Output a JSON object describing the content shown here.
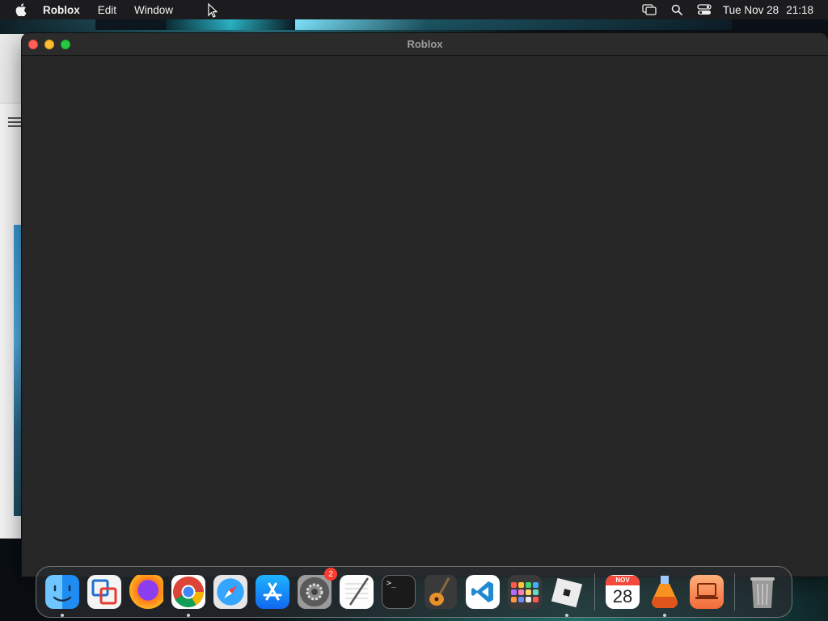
{
  "menubar": {
    "apple_icon": "apple-logo-icon",
    "app_name": "Roblox",
    "menus": [
      "Edit",
      "Window"
    ],
    "status_icons": [
      "screen-mirroring-icon",
      "spotlight-search-icon",
      "control-center-icon"
    ],
    "clock_date": "Tue Nov 28",
    "clock_time": "21:18"
  },
  "window": {
    "title": "Roblox",
    "controls": [
      "close",
      "minimize",
      "zoom"
    ]
  },
  "dock": {
    "apps": [
      {
        "name": "Finder",
        "icon": "finder-icon",
        "running": true
      },
      {
        "name": "VMware Fusion",
        "icon": "vmware-icon",
        "running": false
      },
      {
        "name": "Firefox",
        "icon": "firefox-icon",
        "running": false
      },
      {
        "name": "Google Chrome",
        "icon": "chrome-icon",
        "running": true
      },
      {
        "name": "Safari",
        "icon": "safari-icon",
        "running": false
      },
      {
        "name": "App Store",
        "icon": "app-store-icon",
        "running": false
      },
      {
        "name": "System Settings",
        "icon": "system-settings-icon",
        "running": false,
        "badge": "2"
      },
      {
        "name": "TextEdit",
        "icon": "textedit-icon",
        "running": false
      },
      {
        "name": "Terminal",
        "icon": "terminal-icon",
        "running": false,
        "glyph": ">_"
      },
      {
        "name": "GarageBand",
        "icon": "garageband-icon",
        "running": false
      },
      {
        "name": "Visual Studio Code",
        "icon": "vscode-icon",
        "running": false
      },
      {
        "name": "Launchpad",
        "icon": "launchpad-icon",
        "running": false
      },
      {
        "name": "Roblox",
        "icon": "roblox-icon",
        "running": true
      }
    ],
    "recent": [
      {
        "name": "Calendar",
        "icon": "calendar-icon",
        "running": false,
        "month": "NOV",
        "day": "28"
      },
      {
        "name": "Jumper",
        "icon": "flask-app-icon",
        "running": true
      },
      {
        "name": "Remote Desktop",
        "icon": "remote-desktop-icon",
        "running": false
      }
    ],
    "trash": {
      "name": "Trash",
      "icon": "trash-icon"
    }
  },
  "colors": {
    "menubar_bg": "#1c1c1e",
    "window_bg": "#262626",
    "close": "#fe5f57",
    "minimize": "#febc2e",
    "zoom": "#28c840",
    "badge": "#ff3b30"
  }
}
